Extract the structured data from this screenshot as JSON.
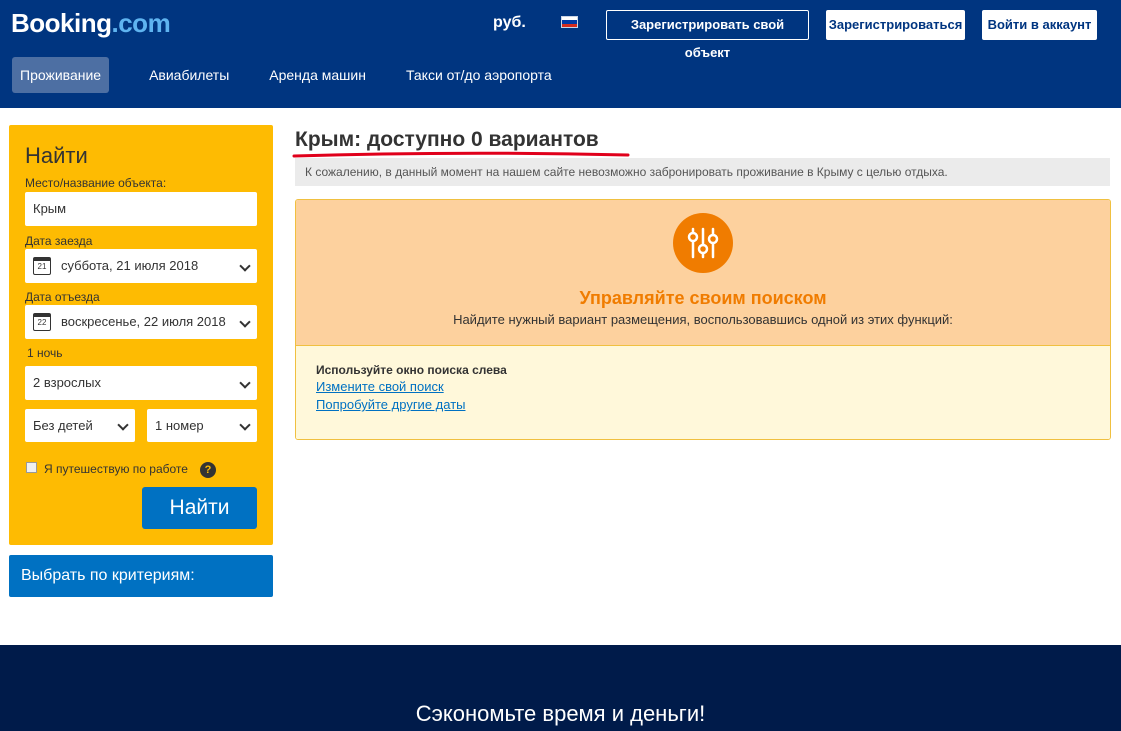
{
  "header": {
    "logo_main": "Booking",
    "logo_suffix": ".com",
    "currency": "руб.",
    "list_property_button": "Зарегистрировать свой объект",
    "register_button": "Зарегистрироваться",
    "signin_button": "Войти в аккаунт",
    "flag_colors": [
      "#ffffff",
      "#0039a6",
      "#d52b1e"
    ]
  },
  "nav": {
    "items": [
      {
        "label": "Проживание",
        "active": true
      },
      {
        "label": "Авиабилеты",
        "active": false
      },
      {
        "label": "Аренда машин",
        "active": false
      },
      {
        "label": "Такси от/до аэропорта",
        "active": false
      }
    ]
  },
  "search": {
    "title": "Найти",
    "destination_label": "Место/название объекта:",
    "destination_value": "Крым",
    "checkin_label": "Дата заезда",
    "checkin_day": "21",
    "checkin_value": "суббота, 21 июля 2018",
    "checkout_label": "Дата отъезда",
    "checkout_day": "22",
    "checkout_value": "воскресенье, 22 июля 2018",
    "nights": "1 ночь",
    "adults": "2 взрослых",
    "children": "Без детей",
    "rooms": "1 номер",
    "work_trip_label": "Я путешествую по работе",
    "help_glyph": "?",
    "submit_label": "Найти"
  },
  "filters": {
    "label": "Выбрать по критериям:"
  },
  "results": {
    "title": "Крым: доступно 0 вариантов",
    "notice": "К сожалению, в данный момент на нашем сайте невозможно забронировать проживание в Крыму с целью отдыха.",
    "panel_heading": "Управляйте своим поиском",
    "panel_subtitle": "Найдите нужный вариант размещения, воспользовавшись одной из этих функций:",
    "option_title": "Используйте окно поиска слева",
    "link_change_search": "Измените свой поиск",
    "link_other_dates": "Попробуйте другие даты"
  },
  "footer": {
    "tagline": "Сэкономьте время и деньги!"
  },
  "colors": {
    "brand_dark": "#003580",
    "brand_blue": "#0071c2",
    "search_yellow": "#febb02",
    "accent_orange": "#f07c00",
    "annotation_red": "#e0001b"
  }
}
